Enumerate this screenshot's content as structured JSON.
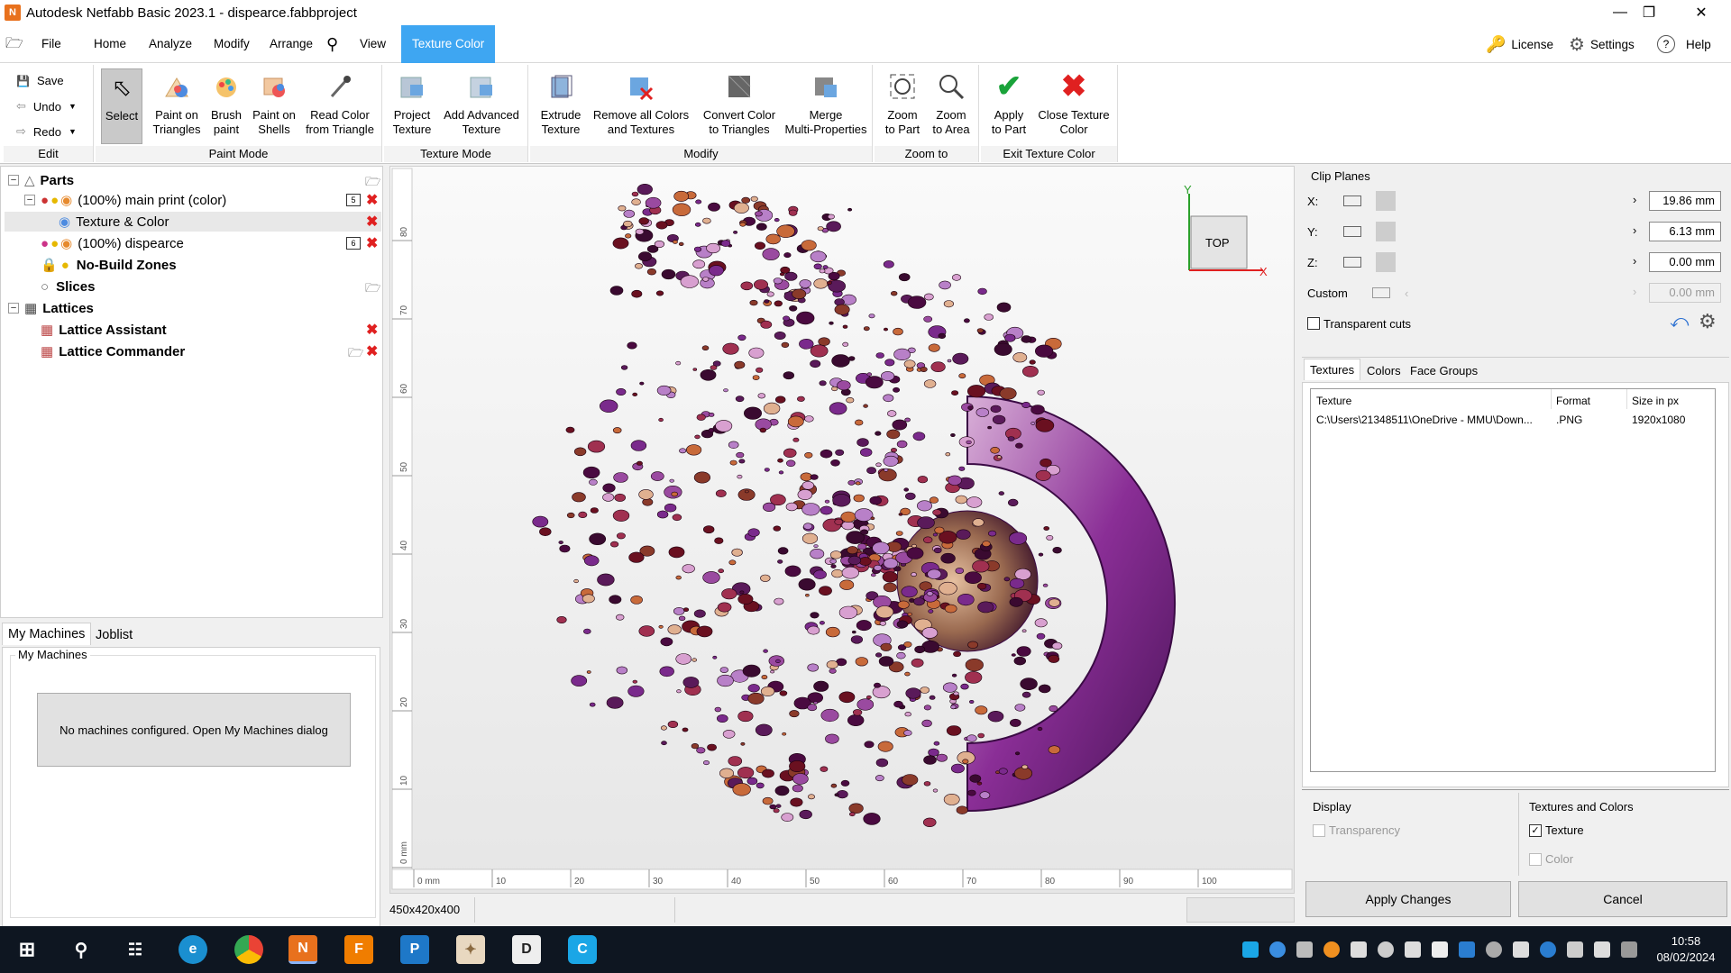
{
  "window": {
    "title": "Autodesk Netfabb Basic 2023.1 - dispearce.fabbproject",
    "app_icon": "N"
  },
  "menu": {
    "items": [
      "File",
      "Home",
      "Analyze",
      "Modify",
      "Arrange",
      "View"
    ],
    "active_tab": "Texture Color",
    "right": {
      "license": "License",
      "settings": "Settings",
      "help": "Help"
    }
  },
  "ribbon": {
    "edit": {
      "save": "Save",
      "undo": "Undo",
      "redo": "Redo",
      "group": "Edit"
    },
    "paint_mode": {
      "select": "Select",
      "paint_triangles": [
        "Paint on",
        "Triangles"
      ],
      "brush_paint": [
        "Brush",
        "paint"
      ],
      "paint_shells": [
        "Paint on",
        "Shells"
      ],
      "read_color": [
        "Read Color",
        "from Triangle"
      ],
      "group": "Paint Mode"
    },
    "texture_mode": {
      "project_texture": [
        "Project",
        "Texture"
      ],
      "add_advanced": [
        "Add Advanced",
        "Texture"
      ],
      "group": "Texture Mode"
    },
    "modify": {
      "extrude": [
        "Extrude",
        "Texture"
      ],
      "remove_all": [
        "Remove all Colors",
        "and Textures"
      ],
      "convert": [
        "Convert Color",
        "to Triangles"
      ],
      "merge": [
        "Merge",
        "Multi-Properties"
      ],
      "group": "Modify"
    },
    "zoom_to": {
      "zoom_part": [
        "Zoom",
        "to Part"
      ],
      "zoom_area": [
        "Zoom",
        "to Area"
      ],
      "group": "Zoom to"
    },
    "exit": {
      "apply": [
        "Apply",
        "to Part"
      ],
      "close": [
        "Close Texture",
        "Color"
      ],
      "group": "Exit Texture Color"
    }
  },
  "tree": {
    "parts": "Parts",
    "main_print": "(100%) main print (color)",
    "main_print_num": "5",
    "texture_color": "Texture & Color",
    "dispearce": "(100%) dispearce",
    "dispearce_num": "6",
    "no_build": "No-Build Zones",
    "slices": "Slices",
    "lattices": "Lattices",
    "lattice_assistant": "Lattice Assistant",
    "lattice_commander": "Lattice Commander"
  },
  "machines": {
    "tabs": [
      "My Machines",
      "Joblist"
    ],
    "group_label": "My Machines",
    "empty_message": "No machines configured. Open My Machines dialog"
  },
  "viewport": {
    "ruler_x_labels": [
      "0 mm",
      "10",
      "20",
      "30",
      "40",
      "50",
      "60",
      "70",
      "80",
      "90",
      "100"
    ],
    "ruler_y_labels": [
      "0 mm",
      "10",
      "20",
      "30",
      "40",
      "50",
      "60",
      "70",
      "80"
    ],
    "axis_y": "Y",
    "axis_x": "X",
    "view_cube": "TOP"
  },
  "status": {
    "dimensions": "450x420x400"
  },
  "clip_planes": {
    "title": "Clip Planes",
    "x_label": "X:",
    "x_value": "19.86 mm",
    "y_label": "Y:",
    "y_value": "6.13 mm",
    "z_label": "Z:",
    "z_value": "0.00 mm",
    "custom_label": "Custom",
    "custom_value": "0.00 mm",
    "transparent_cuts": "Transparent cuts"
  },
  "texture_tabs": [
    "Textures",
    "Colors",
    "Face Groups"
  ],
  "texture_table": {
    "headers": [
      "Texture",
      "Format",
      "Size in px"
    ],
    "rows": [
      [
        "C:\\Users\\21348511\\OneDrive - MMU\\Down...",
        ".PNG",
        "1920x1080"
      ]
    ]
  },
  "display": {
    "title": "Display",
    "transparency": "Transparency"
  },
  "textures_colors": {
    "title": "Textures and Colors",
    "texture": "Texture",
    "color": "Color"
  },
  "buttons": {
    "apply": "Apply Changes",
    "cancel": "Cancel"
  },
  "taskbar": {
    "time": "10:58",
    "date": "08/02/2024"
  },
  "colors": {
    "accent": "#3ea6f2",
    "delete": "#e02020",
    "apply_green": "#1aa33a",
    "purple": "#7a2a8c"
  }
}
